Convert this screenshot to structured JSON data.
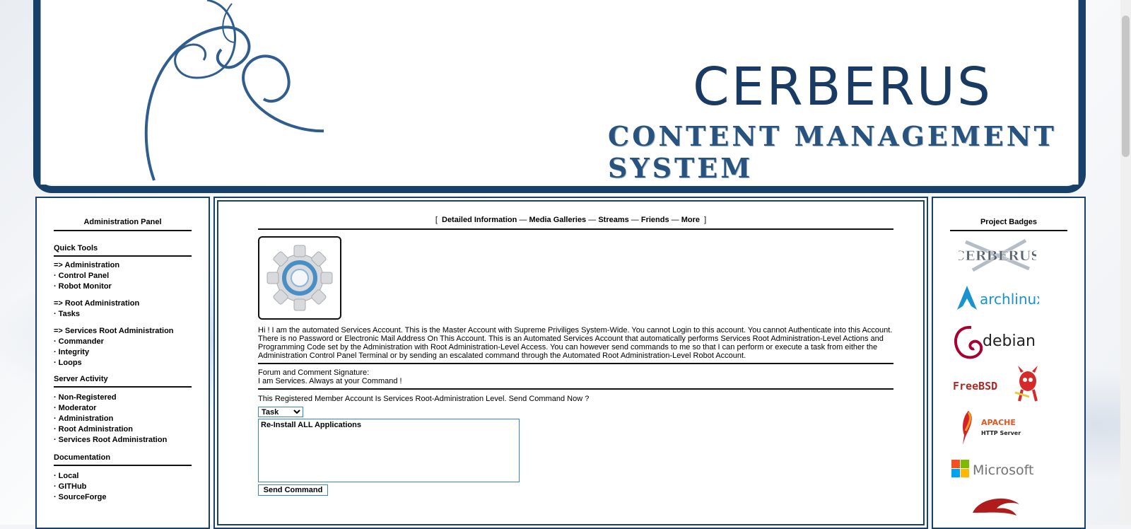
{
  "banner": {
    "title": "CERBERUS",
    "subtitle": "CONTENT MANAGEMENT SYSTEM"
  },
  "left_panel": {
    "title": "Administration Panel",
    "quick_tools": {
      "heading": "Quick Tools",
      "groups": [
        {
          "head": "=> Administration",
          "items": [
            "Control Panel",
            "Robot Monitor"
          ]
        },
        {
          "head": "=> Root Administration",
          "items": [
            "Tasks"
          ]
        },
        {
          "head": "=> Services Root Administration",
          "items": [
            "Commander",
            "Integrity",
            "Loops"
          ]
        }
      ]
    },
    "server_activity": {
      "heading": "Server Activity",
      "items": [
        "Non-Registered",
        "Moderator",
        "Administration",
        "Root Administration",
        "Services Root Administration"
      ]
    },
    "documentation": {
      "heading": "Documentation",
      "items": [
        "Local",
        "GITHub",
        "SourceForge"
      ]
    }
  },
  "center": {
    "nav": {
      "open": "[",
      "close": "]",
      "sep": "—",
      "items": [
        "Detailed Information",
        "Media Galleries",
        "Streams",
        "Friends",
        "More"
      ]
    },
    "avatar_icon": "gear-icon",
    "about": "Hi ! I am the automated Services Account. This is the Master Account with Supreme Priviliges System-Wide. You cannot Login to this account. You cannot Authenticate into this Account. There is no Password or Electronic Mail Address On This Account. This is an Automated Services Account that automatically performs Services Root Administration-Level Actions and Programming Code set by the Administration with Root Administration-Level Access. You can however send commands to me so that I can perform or execute a task from either the Administration Control Panel Terminal or by sending an escalated command through the Automated Root Administration-Level Robot Account.",
    "signature_label": "Forum and Comment Signature:",
    "signature": "I am Services. Always at your Command !",
    "command_prompt": "This Registered Member Account Is Services Root-Administration Level. Send Command Now ?",
    "command_type": "Task",
    "command_text": "Re-Install ALL Applications",
    "send_label": "Send Command"
  },
  "right_panel": {
    "title": "Project Badges",
    "badges": [
      "cerberus-logo",
      "archlinux-logo",
      "debian-logo",
      "freebsd-logo",
      "apache-logo",
      "microsoft-logo",
      "red-logo"
    ],
    "arch_text": "archlinux",
    "debian_text": "debian",
    "freebsd_text": "FreeBSD",
    "apache_text": "APACHE",
    "apache_sub": "HTTP Server",
    "microsoft_text": "Microsoft",
    "cerberus_text": "CERBERUS"
  },
  "colors": {
    "frame": "#17416b",
    "accent": "#3a85c9"
  }
}
